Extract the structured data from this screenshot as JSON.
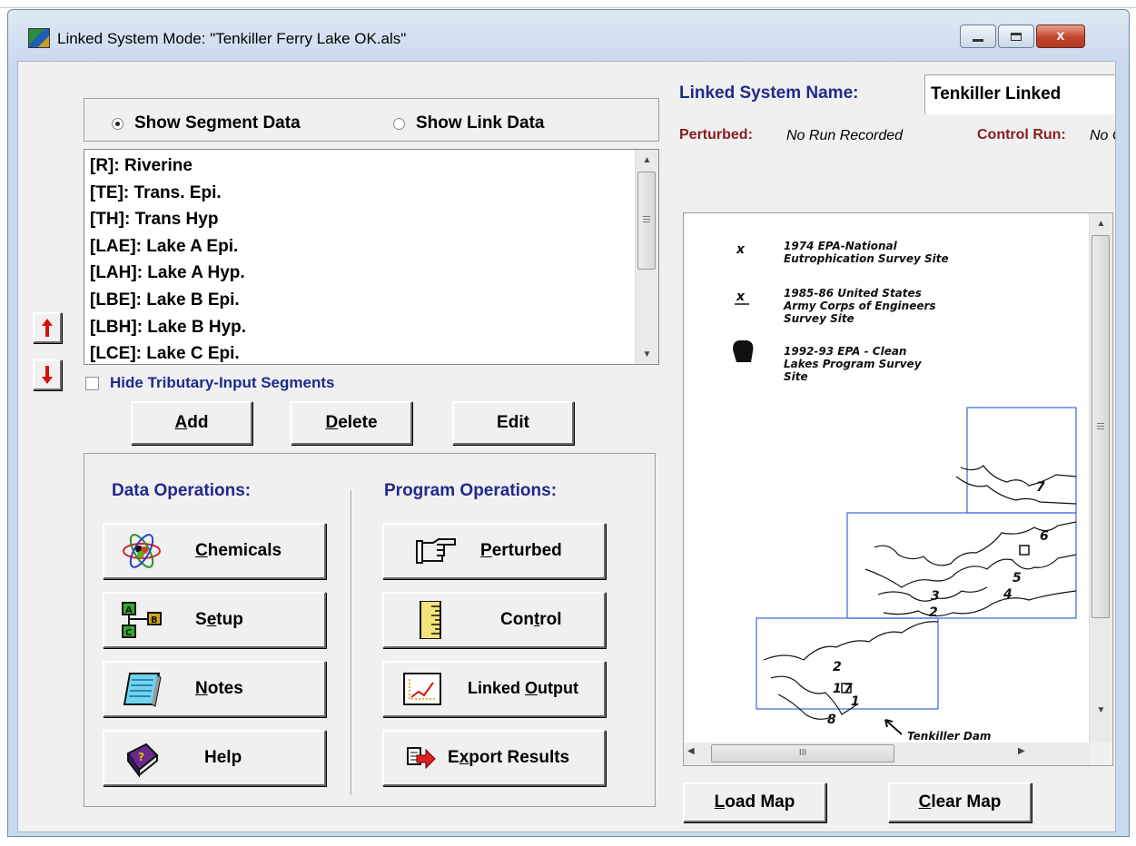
{
  "window": {
    "title": "Linked System Mode: \"Tenkiller Ferry Lake OK.als\"",
    "close_glyph": "x"
  },
  "radio": {
    "show_segment": "Show Segment Data",
    "show_link": "Show Link Data",
    "selected": "show_segment"
  },
  "segments": [
    "[R]: Riverine",
    "[TE]: Trans. Epi.",
    "[TH]: Trans Hyp",
    "[LAE]: Lake A Epi.",
    "[LAH]: Lake A Hyp.",
    "[LBE]: Lake B Epi.",
    "[LBH]: Lake B Hyp.",
    "[LCE]: Lake C Epi."
  ],
  "hide_tributary": {
    "label": "Hide Tributary-Input Segments",
    "checked": false
  },
  "list_buttons": {
    "add": "A",
    "add_rest": "dd",
    "delete": "D",
    "delete_rest": "elete",
    "edit": "Edit"
  },
  "data_ops": {
    "heading": "Data Operations:",
    "chemicals_u": "C",
    "chemicals_rest": "hemicals",
    "setup_pre": "S",
    "setup_u": "e",
    "setup_rest": "tup",
    "notes_u": "N",
    "notes_rest": "otes",
    "help": "Help"
  },
  "program_ops": {
    "heading": "Program Operations:",
    "perturbed_u": "P",
    "perturbed_rest": "erturbed",
    "control_pre": "Con",
    "control_u": "t",
    "control_rest": "rol",
    "linked_pre": "Linked ",
    "linked_u": "O",
    "linked_rest": "utput",
    "export_pre": "E",
    "export_u": "x",
    "export_rest": "port Results"
  },
  "linked_system": {
    "label": "Linked System Name:",
    "name": "Tenkiller Linked",
    "perturbed_label": "Perturbed:",
    "perturbed_value": "No Run Recorded",
    "control_label": "Control Run:",
    "control_value": "No C"
  },
  "map": {
    "legend": [
      {
        "marker": "x",
        "text1": "1974 EPA-National",
        "text2": "Eutrophication Survey Site",
        "text3": ""
      },
      {
        "marker": "x",
        "text1": "1985-86 United States",
        "text2": "Army Corps of Engineers",
        "text3": "Survey Site"
      },
      {
        "marker": "",
        "text1": "1992-93 EPA - Clean",
        "text2": "Lakes Program Survey",
        "text3": "Site"
      }
    ],
    "site_labels": [
      "7",
      "6",
      "5",
      "4",
      "3",
      "2",
      "2",
      "1",
      "7",
      "1",
      "8"
    ],
    "dam_label": "Tenkiller Dam",
    "hscroll_grip": "III"
  },
  "map_buttons": {
    "load_u": "L",
    "load_rest": "oad Map",
    "clear_u": "C",
    "clear_rest": "lear Map"
  },
  "colors": {
    "navy": "#1f2a8a",
    "maroon": "#8a1c1c",
    "dialog_bg": "#f0f0f0",
    "map_box": "#3b66d6"
  }
}
